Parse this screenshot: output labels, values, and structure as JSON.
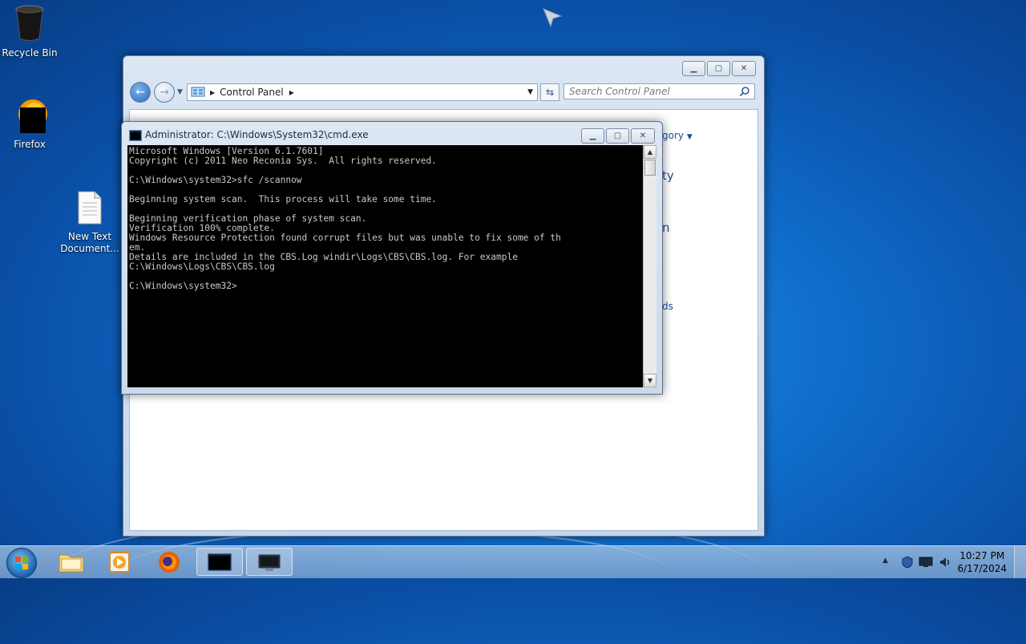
{
  "desktop": {
    "icons": [
      {
        "label": "Recycle Bin"
      },
      {
        "label": "Firefox"
      },
      {
        "label": "New Text Document...",
        "label_line1": "New Text",
        "label_line2": "Document..."
      }
    ]
  },
  "control_panel": {
    "breadcrumb": "Control Panel",
    "search_placeholder": "Search Control Panel",
    "view_by_fragment": "gory",
    "link_fragments": [
      "ty",
      "n",
      "ds"
    ]
  },
  "cmd": {
    "title": "Administrator: C:\\Windows\\System32\\cmd.exe",
    "lines": [
      "Microsoft Windows [Version 6.1.7601]",
      "Copyright (c) 2011 Neo Reconia Sys.  All rights reserved.",
      "",
      "C:\\Windows\\system32>sfc /scannow",
      "",
      "Beginning system scan.  This process will take some time.",
      "",
      "Beginning verification phase of system scan.",
      "Verification 100% complete.",
      "Windows Resource Protection found corrupt files but was unable to fix some of th",
      "em.",
      "Details are included in the CBS.Log windir\\Logs\\CBS\\CBS.log. For example",
      "C:\\Windows\\Logs\\CBS\\CBS.log",
      "",
      "C:\\Windows\\system32>"
    ]
  },
  "taskbar": {
    "clock_time": "10:27 PM",
    "clock_date": "6/17/2024",
    "items": [
      "start-button",
      "explorer",
      "media-player",
      "firefox",
      "cmd",
      "control-panel"
    ]
  },
  "colors": {
    "desktop_bg": "#0f6cc9",
    "link": "#1e4f95",
    "console_bg": "#000000",
    "console_fg": "#c8c8c8"
  }
}
